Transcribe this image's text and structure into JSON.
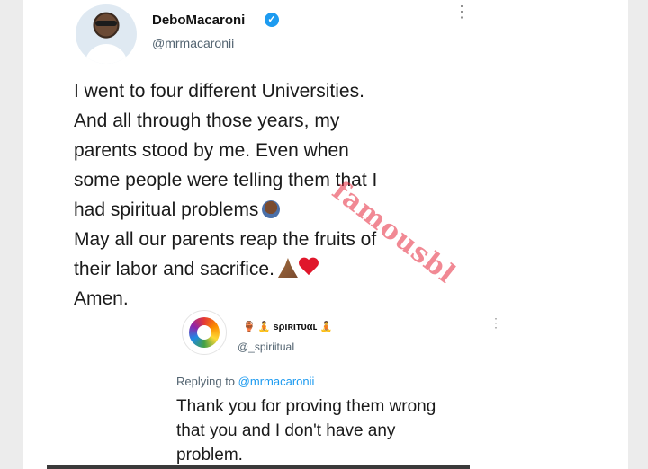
{
  "tweet": {
    "author_name": "DeboMacaroni",
    "author_handle": "@mrmacaronii",
    "verified_glyph": "✓",
    "more_glyph": "⋮",
    "lines": [
      "I went to four different Universities.",
      "And all through those years, my",
      "parents stood by me. Even when",
      "some people were telling them that I",
      "had spiritual problems",
      "May all our parents reap the fruits of",
      "their labor and sacrifice.",
      "Amen."
    ],
    "emoji_icons": [
      "facepalm-icon",
      "praying-hands-icon",
      "red-heart-icon"
    ]
  },
  "watermark": "famousbl",
  "quoted_tweet": {
    "author_name": "🏺 🧘 ѕριʀιтυαʟ 🧘",
    "author_handle": "@_spiriituaL",
    "more_glyph": "⋮",
    "replying_prefix": "Replying to",
    "replying_handle": "@mrmacaronii",
    "lines": [
      "Thank you for proving them wrong",
      "that you and I don't have any",
      "problem."
    ]
  },
  "colors": {
    "accent": "#1d9bf0",
    "watermark": "#e6283c",
    "text": "#1a1a1a",
    "secondary_text": "#536471"
  }
}
